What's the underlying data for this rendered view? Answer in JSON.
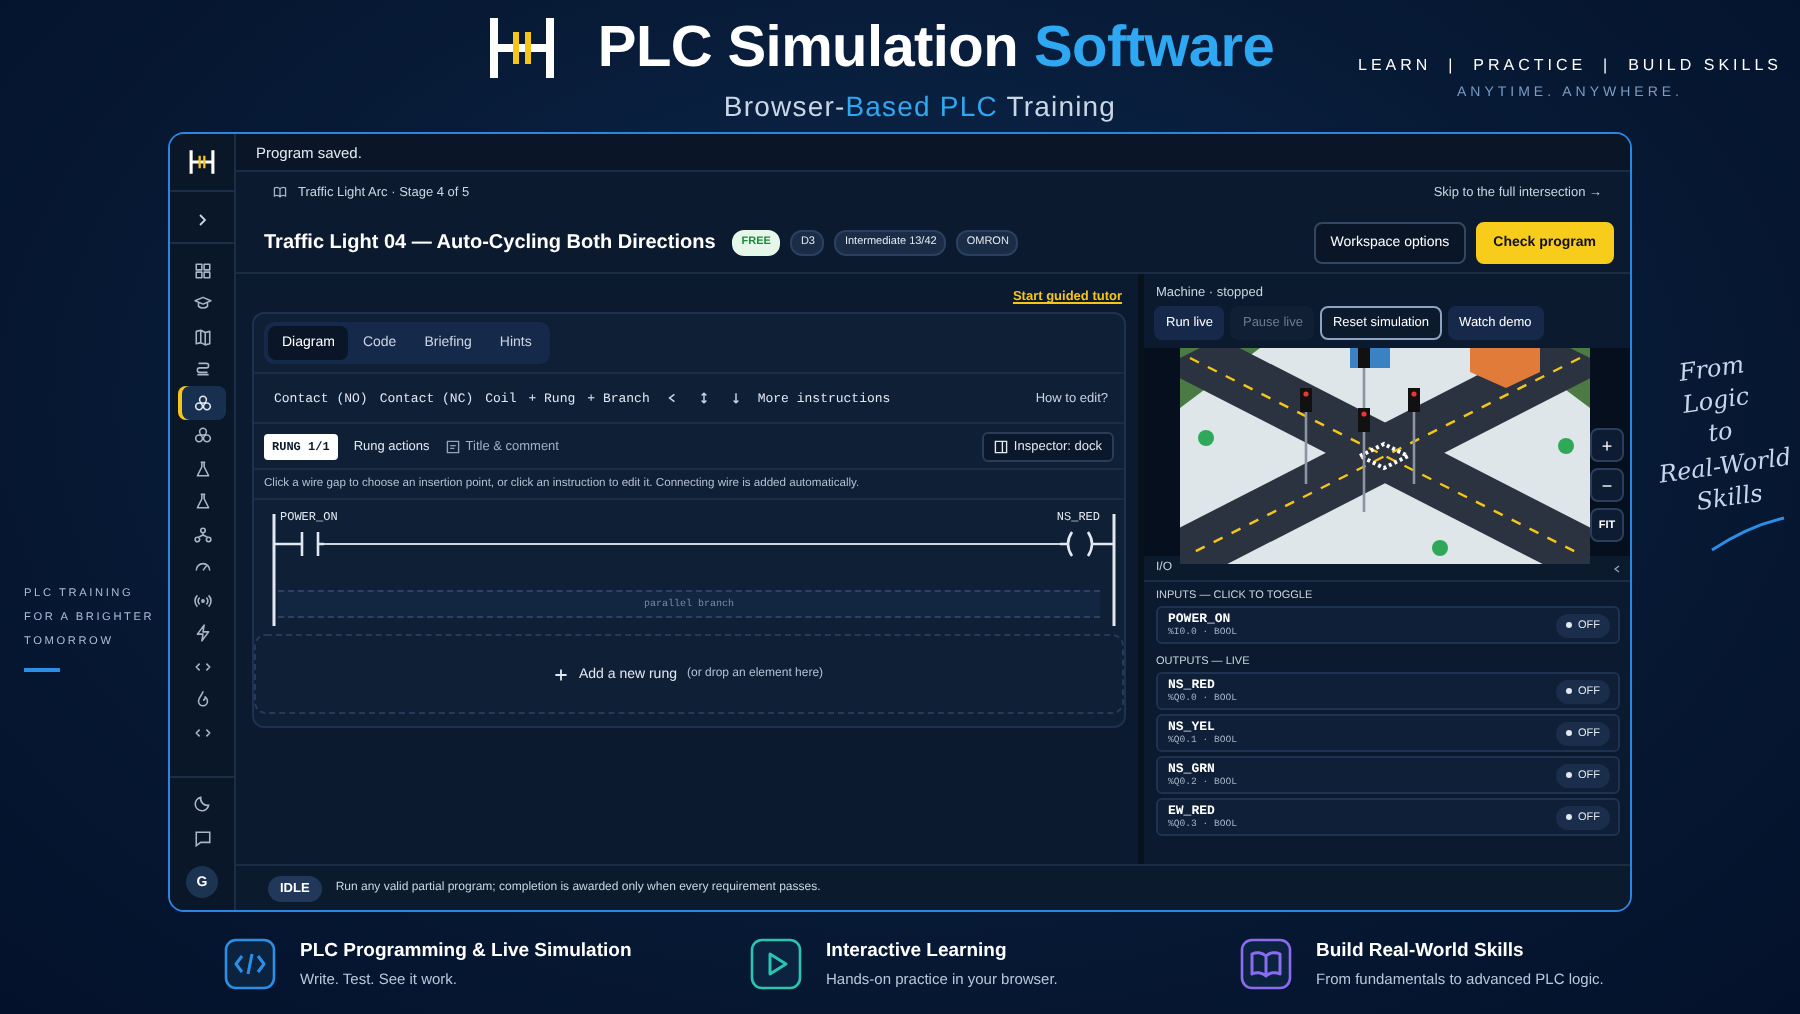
{
  "header": {
    "title": [
      {
        "text": "PLC Simulation",
        "accent": false
      },
      {
        "text": "Software",
        "accent": true
      }
    ],
    "subtitle": [
      {
        "text": "Browser-",
        "accent": false
      },
      {
        "text": "Based PLC",
        "accent": true
      },
      {
        "text": " Training",
        "accent": false
      }
    ],
    "tagline": "LEARN  |  PRACTICE  |  BUILD SKILLS",
    "tagline_sub": "ANYTIME. ANYWHERE."
  },
  "side_note": {
    "lines": [
      "PLC TRAINING",
      "FOR A BRIGHTER",
      "TOMORROW"
    ]
  },
  "script_note": {
    "lines": [
      "From",
      "Logic",
      "to",
      "Real-World",
      "Skills"
    ]
  },
  "app": {
    "status_message": "Program saved.",
    "sidebar": {
      "items": [
        {
          "selected": false
        },
        {
          "selected": false
        },
        {
          "selected": false
        },
        {
          "selected": false
        },
        {
          "selected": true
        },
        {
          "selected": false
        },
        {
          "selected": false
        },
        {
          "selected": false
        },
        {
          "selected": false
        },
        {
          "selected": false
        },
        {
          "selected": false
        },
        {
          "selected": false
        },
        {
          "selected": false
        },
        {
          "selected": false
        },
        {
          "selected": false
        }
      ],
      "avatar": "G"
    },
    "breadcrumb": "Traffic Light Arc · Stage 4 of 5",
    "skip_link": "Skip to the full intersection →",
    "title": "Traffic Light 04 — Auto-Cycling Both Directions",
    "badges": [
      {
        "text": "FREE",
        "kind": "free"
      },
      {
        "text": "D3",
        "kind": "plain"
      },
      {
        "text": "Intermediate 13/42",
        "kind": "plain"
      },
      {
        "text": "OMRON",
        "kind": "plain"
      }
    ],
    "actions": [
      {
        "label": "Workspace options",
        "kind": "secondary"
      },
      {
        "label": "Check program",
        "kind": "primary"
      }
    ],
    "tutor_link": "Start guided tutor",
    "tabs": [
      {
        "label": "Diagram",
        "selected": true
      },
      {
        "label": "Code",
        "selected": false
      },
      {
        "label": "Briefing",
        "selected": false
      },
      {
        "label": "Hints",
        "selected": false
      }
    ],
    "toolbar": {
      "items": [
        "Contact (NO)",
        "Contact (NC)",
        "Coil",
        "+ Rung",
        "+ Branch"
      ],
      "more": "More instructions",
      "help": "How to edit?"
    },
    "rung_bar": {
      "rung": "RUNG 1/1",
      "actions": "Rung actions",
      "comment": "Title & comment",
      "inspector": "Inspector: dock"
    },
    "hint": "Click a wire gap to choose an insertion point, or click an instruction to edit it. Connecting wire is added automatically.",
    "rung": {
      "contact": "POWER_ON",
      "coil": "NS_RED",
      "branch": "parallel branch"
    },
    "add_rung": {
      "label": "Add a new rung",
      "note": "(or drop an element here)"
    },
    "status": {
      "badge": "IDLE",
      "message": "Run any valid partial program; completion is awarded only when every requirement passes."
    },
    "machine": "Machine · stopped",
    "sim_buttons": [
      {
        "label": "Run live",
        "disabled": false,
        "selected": false
      },
      {
        "label": "Pause live",
        "disabled": true,
        "selected": false
      },
      {
        "label": "Reset simulation",
        "disabled": false,
        "selected": true
      },
      {
        "label": "Watch demo",
        "disabled": false,
        "selected": false
      }
    ],
    "zoom": [
      "+",
      "−",
      "FIT"
    ],
    "io": {
      "title": "I/O",
      "inputs_heading": "INPUTS — CLICK TO TOGGLE",
      "inputs": [
        {
          "name": "POWER_ON",
          "address": "%I0.0 · BOOL",
          "on": false,
          "state": "OFF"
        }
      ],
      "outputs_heading": "OUTPUTS — LIVE",
      "outputs": [
        {
          "name": "NS_RED",
          "address": "%Q0.0 · BOOL",
          "on": false,
          "state": "OFF"
        },
        {
          "name": "NS_YEL",
          "address": "%Q0.1 · BOOL",
          "on": false,
          "state": "OFF"
        },
        {
          "name": "NS_GRN",
          "address": "%Q0.2 · BOOL",
          "on": false,
          "state": "OFF"
        },
        {
          "name": "EW_RED",
          "address": "%Q0.3 · BOOL",
          "on": false,
          "state": "OFF"
        }
      ]
    }
  },
  "features": [
    {
      "kind": "code",
      "color": "#2b8fe6",
      "title": "PLC Programming & Live Simulation",
      "text": "Write. Test. See it work."
    },
    {
      "kind": "play",
      "color": "#2bc4b0",
      "title": "Interactive Learning",
      "text": "Hands-on practice in your browser."
    },
    {
      "kind": "book",
      "color": "#8a6cf0",
      "title": "Build Real-World Skills",
      "text": "From fundamentals to advanced PLC logic."
    }
  ]
}
